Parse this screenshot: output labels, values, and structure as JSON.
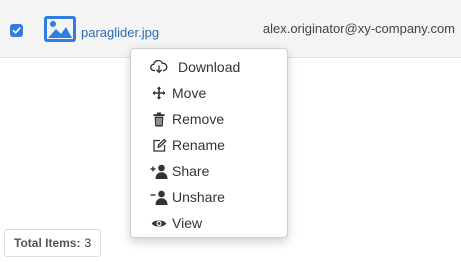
{
  "file_row": {
    "selected": true,
    "file_icon": "image-file-icon",
    "file_name": "paraglider.jpg",
    "owner": "alex.originator@xy-company.com"
  },
  "context_menu": {
    "items": [
      {
        "label": "Download",
        "icon": "cloud-download-icon"
      },
      {
        "label": "Move",
        "icon": "move-arrows-icon"
      },
      {
        "label": "Remove",
        "icon": "trash-icon"
      },
      {
        "label": "Rename",
        "icon": "edit-icon"
      },
      {
        "label": "Share",
        "icon": "user-plus-icon"
      },
      {
        "label": "Unshare",
        "icon": "user-minus-icon"
      },
      {
        "label": "View",
        "icon": "eye-icon"
      }
    ]
  },
  "footer": {
    "total_label": "Total Items:",
    "total_value": "3"
  },
  "colors": {
    "accent": "#2f7de1",
    "link": "#2b6cb0",
    "row_background": "#f4f4f4"
  }
}
